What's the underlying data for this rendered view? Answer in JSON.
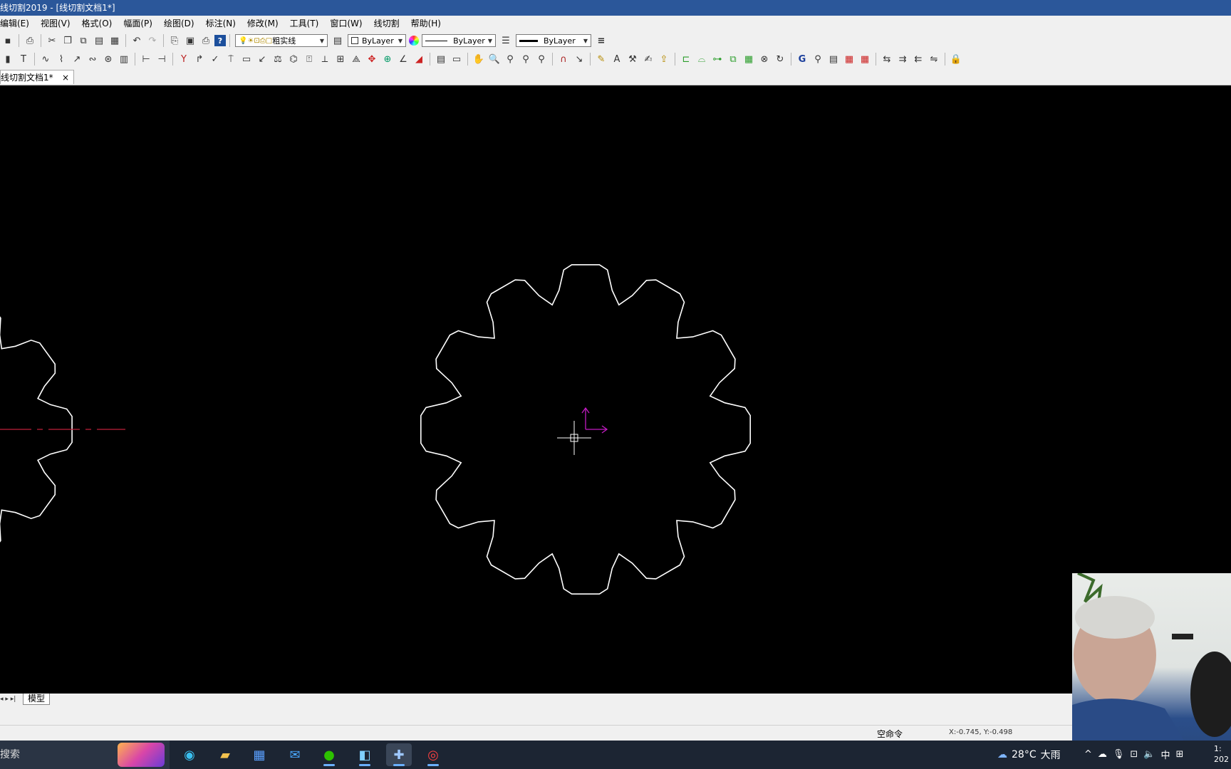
{
  "window": {
    "title": "线切割2019 - [线切割文档1*]"
  },
  "menu": [
    "编辑(E)",
    "视图(V)",
    "格式(O)",
    "幅面(P)",
    "绘图(D)",
    "标注(N)",
    "修改(M)",
    "工具(T)",
    "窗口(W)",
    "线切割",
    "帮助(H)"
  ],
  "toolbar": {
    "layer_combo": "粗实线",
    "color_combo": "ByLayer",
    "linetype_combo": "ByLayer",
    "lineweight_combo": "ByLayer"
  },
  "doc_tab": {
    "label": "线切割文档1*",
    "close": "×"
  },
  "layout_tab": {
    "label": "模型",
    "nav": "◂ ▸ ▸|"
  },
  "status": {
    "command": "空命令",
    "coords": "X:-0.745, Y:-0.498"
  },
  "taskbar": {
    "search_text": "搜索",
    "weather_temp": "28°C",
    "weather_desc": "大雨",
    "ime": "中",
    "clock": [
      "1:",
      "202"
    ]
  },
  "colors": {
    "titlebar": "#2b579a",
    "canvas": "#000000",
    "gear": "#ffffff",
    "ucs": "#c21bc2",
    "centerline": "#c0203a"
  }
}
